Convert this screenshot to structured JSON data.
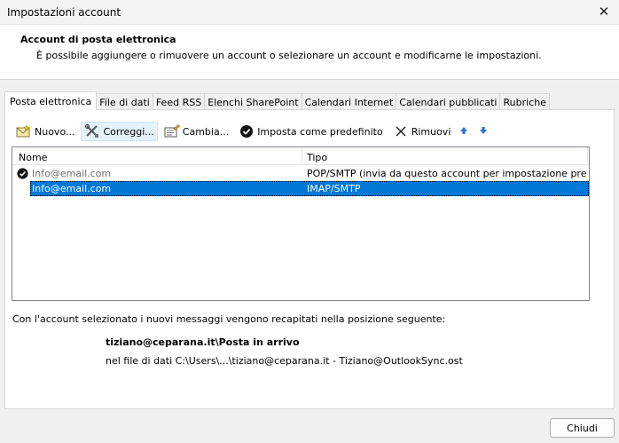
{
  "window": {
    "title": "Impostazioni account",
    "close_glyph": "✕"
  },
  "header": {
    "title": "Account di posta elettronica",
    "subtitle": "È possibile aggiungere o rimuovere un account o selezionare un account e modificarne le impostazioni."
  },
  "tabs": [
    {
      "label": "Posta elettronica",
      "active": true
    },
    {
      "label": "File di dati",
      "active": false
    },
    {
      "label": "Feed RSS",
      "active": false
    },
    {
      "label": "Elenchi SharePoint",
      "active": false
    },
    {
      "label": "Calendari Internet",
      "active": false
    },
    {
      "label": "Calendari pubblicati",
      "active": false
    },
    {
      "label": "Rubriche",
      "active": false
    }
  ],
  "toolbar": {
    "new_label": "Nuovo...",
    "repair_label": "Correggi...",
    "change_label": "Cambia...",
    "default_label": "Imposta come predefinito",
    "remove_label": "Rimuovi",
    "icons": [
      "new-account-icon",
      "repair-tools-icon",
      "change-card-icon",
      "check-circle-icon",
      "remove-x-icon",
      "arrow-up-icon",
      "arrow-down-icon"
    ],
    "arrow_color": "#2f6fdc"
  },
  "accounts": {
    "columns": {
      "name": "Nome",
      "type": "Tipo"
    },
    "rows": [
      {
        "name": "Info@email.com",
        "type": "POP/SMTP (invia da questo account per impostazione pred...",
        "is_default": true,
        "selected": false
      },
      {
        "name": "Info@email.com",
        "type": "IMAP/SMTP",
        "is_default": false,
        "selected": true
      }
    ],
    "selection_color": "#0078d7"
  },
  "delivery": {
    "info": "Con l'account selezionato i nuovi messaggi vengono recapitati nella posizione seguente:",
    "folder": "tiziano@ceparana.it\\Posta in arrivo",
    "file": "nel file di dati C:\\Users\\...\\tiziano@ceparana.it - Tiziano@OutlookSync.ost"
  },
  "footer": {
    "close_label": "Chiudi"
  }
}
